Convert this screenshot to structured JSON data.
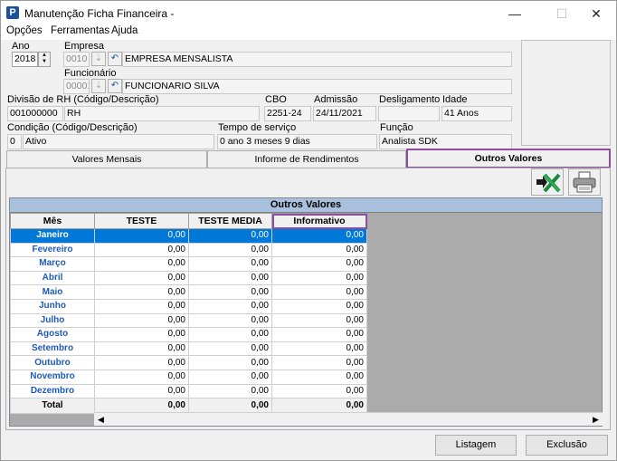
{
  "window": {
    "title": "Manutenção Ficha Financeira -",
    "icon_letter": "P"
  },
  "menu": [
    "Opções",
    "Ferramentas",
    "Ajuda"
  ],
  "header": {
    "ano_label": "Ano",
    "ano_value": "2018",
    "empresa_label": "Empresa",
    "empresa_code": "0010",
    "empresa_name": "EMPRESA MENSALISTA",
    "funcionario_label": "Funcionário",
    "funcionario_code": "00001",
    "funcionario_name": "FUNCIONARIO SILVA",
    "divisao_label": "Divisão de RH (Código/Descrição)",
    "divisao_code": "001000000",
    "divisao_desc": "RH",
    "cbo_label": "CBO",
    "cbo_value": "2251-24",
    "admissao_label": "Admissão",
    "admissao_value": "24/11/2021",
    "desligamento_label": "Desligamento",
    "desligamento_value": "",
    "idade_label": "Idade",
    "idade_value": "41 Anos",
    "condicao_label": "Condição (Código/Descrição)",
    "condicao_code": "0",
    "condicao_desc": "Ativo",
    "tempo_label": "Tempo de serviço",
    "tempo_value": "0 ano 3 meses 9 dias",
    "funcao_label": "Função",
    "funcao_value": "Analista SDK"
  },
  "tabs": [
    "Valores Mensais",
    "Informe de Rendimentos",
    "Outros Valores"
  ],
  "active_tab": "Outros Valores",
  "grid": {
    "title": "Outros Valores",
    "columns": [
      "Mês",
      "TESTE",
      "TESTE MEDIA",
      "Informativo"
    ],
    "rows": [
      [
        "Janeiro",
        "0,00",
        "0,00",
        "0,00"
      ],
      [
        "Fevereiro",
        "0,00",
        "0,00",
        "0,00"
      ],
      [
        "Março",
        "0,00",
        "0,00",
        "0,00"
      ],
      [
        "Abril",
        "0,00",
        "0,00",
        "0,00"
      ],
      [
        "Maio",
        "0,00",
        "0,00",
        "0,00"
      ],
      [
        "Junho",
        "0,00",
        "0,00",
        "0,00"
      ],
      [
        "Julho",
        "0,00",
        "0,00",
        "0,00"
      ],
      [
        "Agosto",
        "0,00",
        "0,00",
        "0,00"
      ],
      [
        "Setembro",
        "0,00",
        "0,00",
        "0,00"
      ],
      [
        "Outubro",
        "0,00",
        "0,00",
        "0,00"
      ],
      [
        "Novembro",
        "0,00",
        "0,00",
        "0,00"
      ],
      [
        "Dezembro",
        "0,00",
        "0,00",
        "0,00"
      ]
    ],
    "total": [
      "Total",
      "0,00",
      "0,00",
      "0,00"
    ]
  },
  "buttons": {
    "listagem": "Listagem",
    "exclusao": "Exclusão"
  },
  "colors": {
    "accent": "#8c4ea0",
    "selection": "#0078d7",
    "grid_title": "#a9c1dd",
    "month_text": "#1e5bb8"
  }
}
